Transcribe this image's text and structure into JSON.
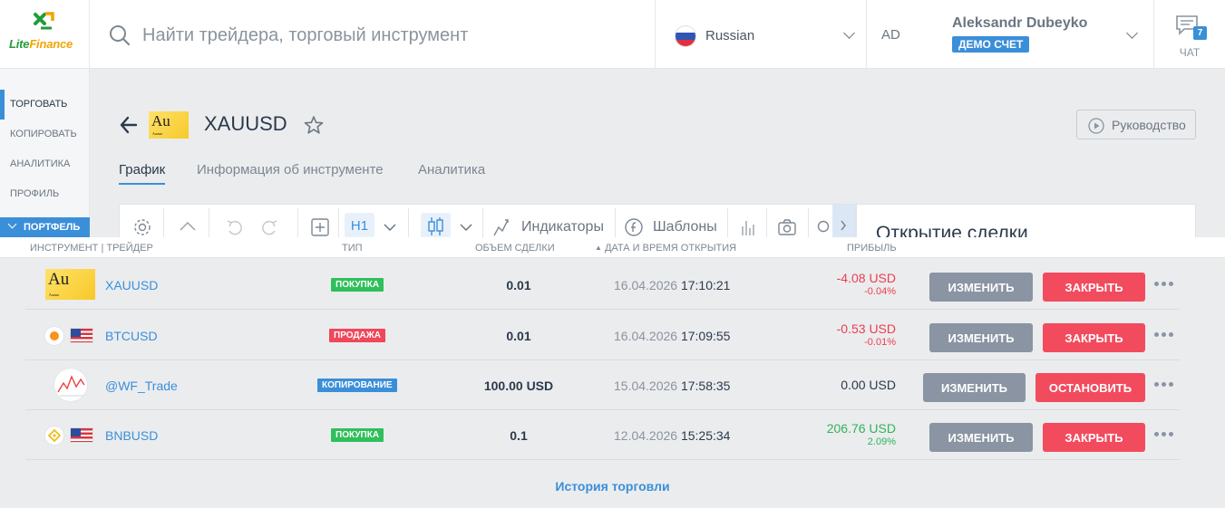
{
  "header": {
    "logo": {
      "part1": "Lite",
      "part2": "Finance"
    },
    "search_placeholder": "Найти трейдера, торговый инструмент",
    "language": "Russian",
    "account": {
      "initials": "AD",
      "name": "Aleksandr Dubeyko",
      "badge": "ДЕМО СЧЕТ"
    },
    "chat": {
      "label": "ЧАТ",
      "count": "7"
    }
  },
  "sidebar": {
    "items": [
      {
        "label": "ТОРГОВАТЬ",
        "active": true
      },
      {
        "label": "КОПИРОВАТЬ"
      },
      {
        "label": "АНАЛИТИКА"
      },
      {
        "label": "ПРОФИЛЬ"
      }
    ],
    "portfolio": "ПОРТФЕЛЬ"
  },
  "instrument": {
    "symbol": "XAUUSD",
    "logo_symbol": "Au",
    "logo_sub": "Aurum",
    "guide_label": "Руководство",
    "tabs": [
      "График",
      "Информация об инструменте",
      "Аналитика"
    ]
  },
  "toolbar": {
    "timeframe": "H1",
    "indicators": "Индикаторы",
    "templates": "Шаблоны"
  },
  "deal_panel": {
    "title": "Открытие сделки"
  },
  "table": {
    "headers": {
      "instrument": "ИНСТРУМЕНТ | ТРЕЙДЕР",
      "type": "ТИП",
      "volume": "ОБЪЕМ СДЕЛКИ",
      "datetime": "ДАТА И ВРЕМЯ ОТКРЫТИЯ",
      "profit": "ПРИБЫЛЬ"
    },
    "rows": [
      {
        "name": "XAUUSD",
        "type": "ПОКУПКА",
        "volume": "0.01",
        "date": "16.04.2026",
        "time": "17:10:21",
        "profit_usd": "-4.08 USD",
        "profit_pct": "-0.04%",
        "edit": "ИЗМЕНИТЬ",
        "action": "ЗАКРЫТЬ"
      },
      {
        "name": "BTCUSD",
        "type": "ПРОДАЖА",
        "volume": "0.01",
        "date": "16.04.2026",
        "time": "17:09:55",
        "profit_usd": "-0.53 USD",
        "profit_pct": "-0.01%",
        "edit": "ИЗМЕНИТЬ",
        "action": "ЗАКРЫТЬ"
      },
      {
        "name": "@WF_Trade",
        "type": "КОПИРОВАНИЕ",
        "volume": "100.00 USD",
        "date": "15.04.2026",
        "time": "17:58:35",
        "profit_usd": "0.00 USD",
        "profit_pct": "",
        "edit": "ИЗМЕНИТЬ",
        "action": "ОСТАНОВИТЬ"
      },
      {
        "name": "BNBUSD",
        "type": "ПОКУПКА",
        "volume": "0.1",
        "date": "12.04.2026",
        "time": "15:25:34",
        "profit_usd": "206.76 USD",
        "profit_pct": "2.09%",
        "edit": "ИЗМЕНИТЬ",
        "action": "ЗАКРЫТЬ"
      }
    ],
    "history_link": "История торговли"
  },
  "colors": {
    "accent": "#3b8fd9",
    "buy": "#2fbf5b",
    "sell": "#f0475a",
    "negative": "#ea3e4f",
    "positive": "#2fb35a",
    "edit_button": "#8a94a3",
    "close_button": "#f24b5e"
  }
}
